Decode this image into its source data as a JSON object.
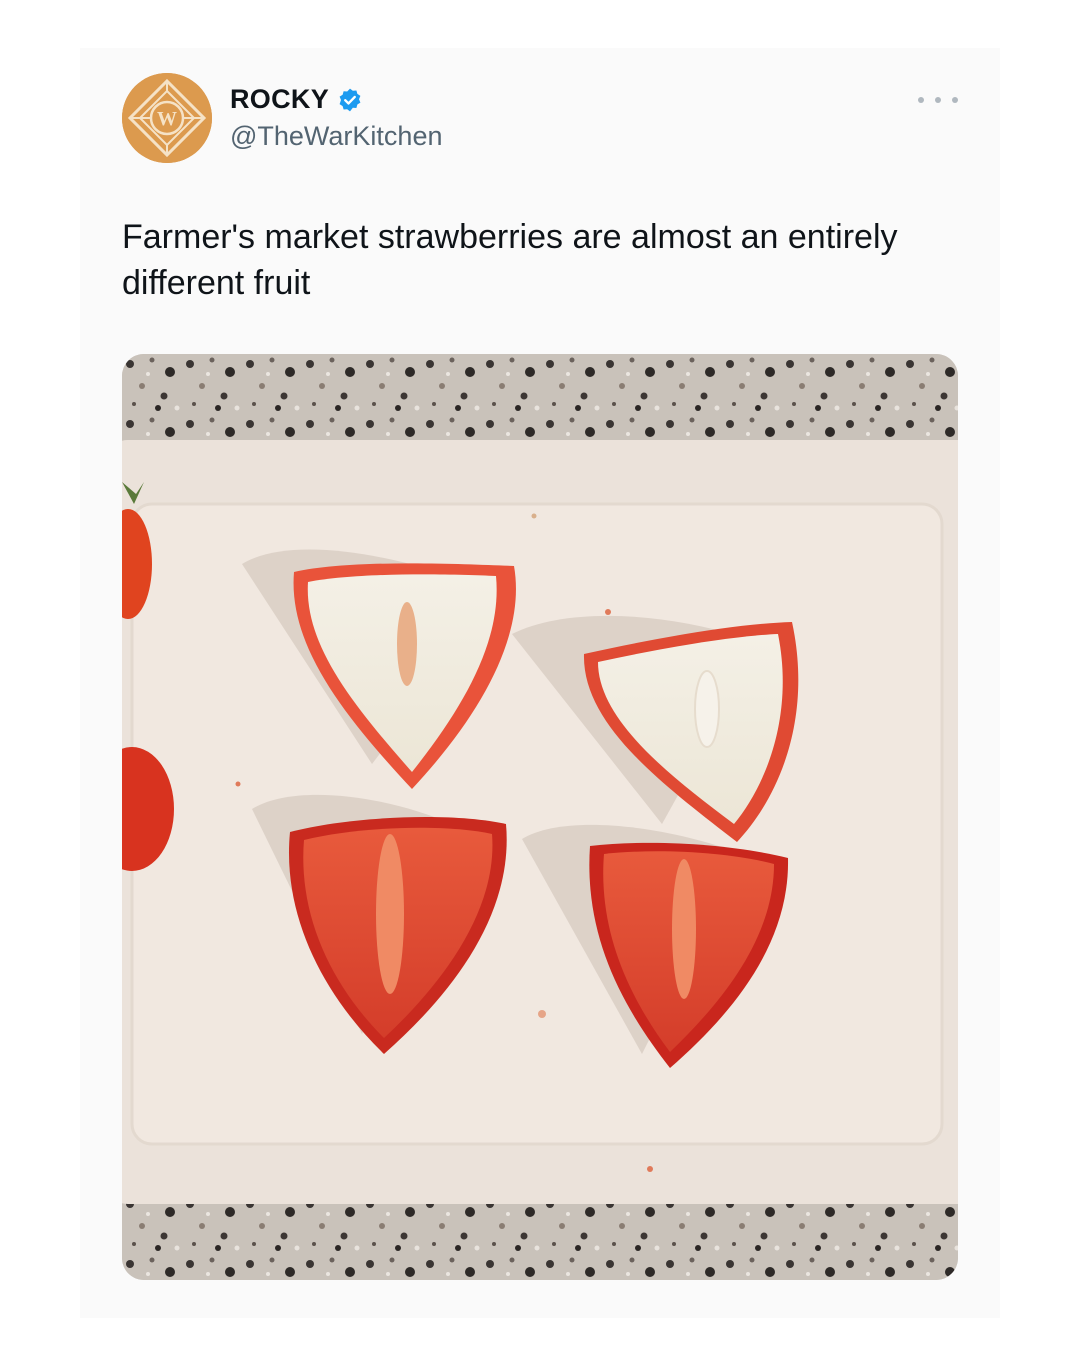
{
  "tweet": {
    "author_name": "ROCKY",
    "verified": true,
    "handle": "@TheWarKitchen",
    "text": "Farmer's market strawberries are almost an entirely different fruit",
    "avatar_letter": "W"
  },
  "icons": {
    "verified": "verified-badge-icon",
    "more": "more-options-icon"
  },
  "colors": {
    "verified_blue": "#1d9bf0",
    "avatar_gold": "#dc9a4e",
    "handle_gray": "#536471"
  }
}
